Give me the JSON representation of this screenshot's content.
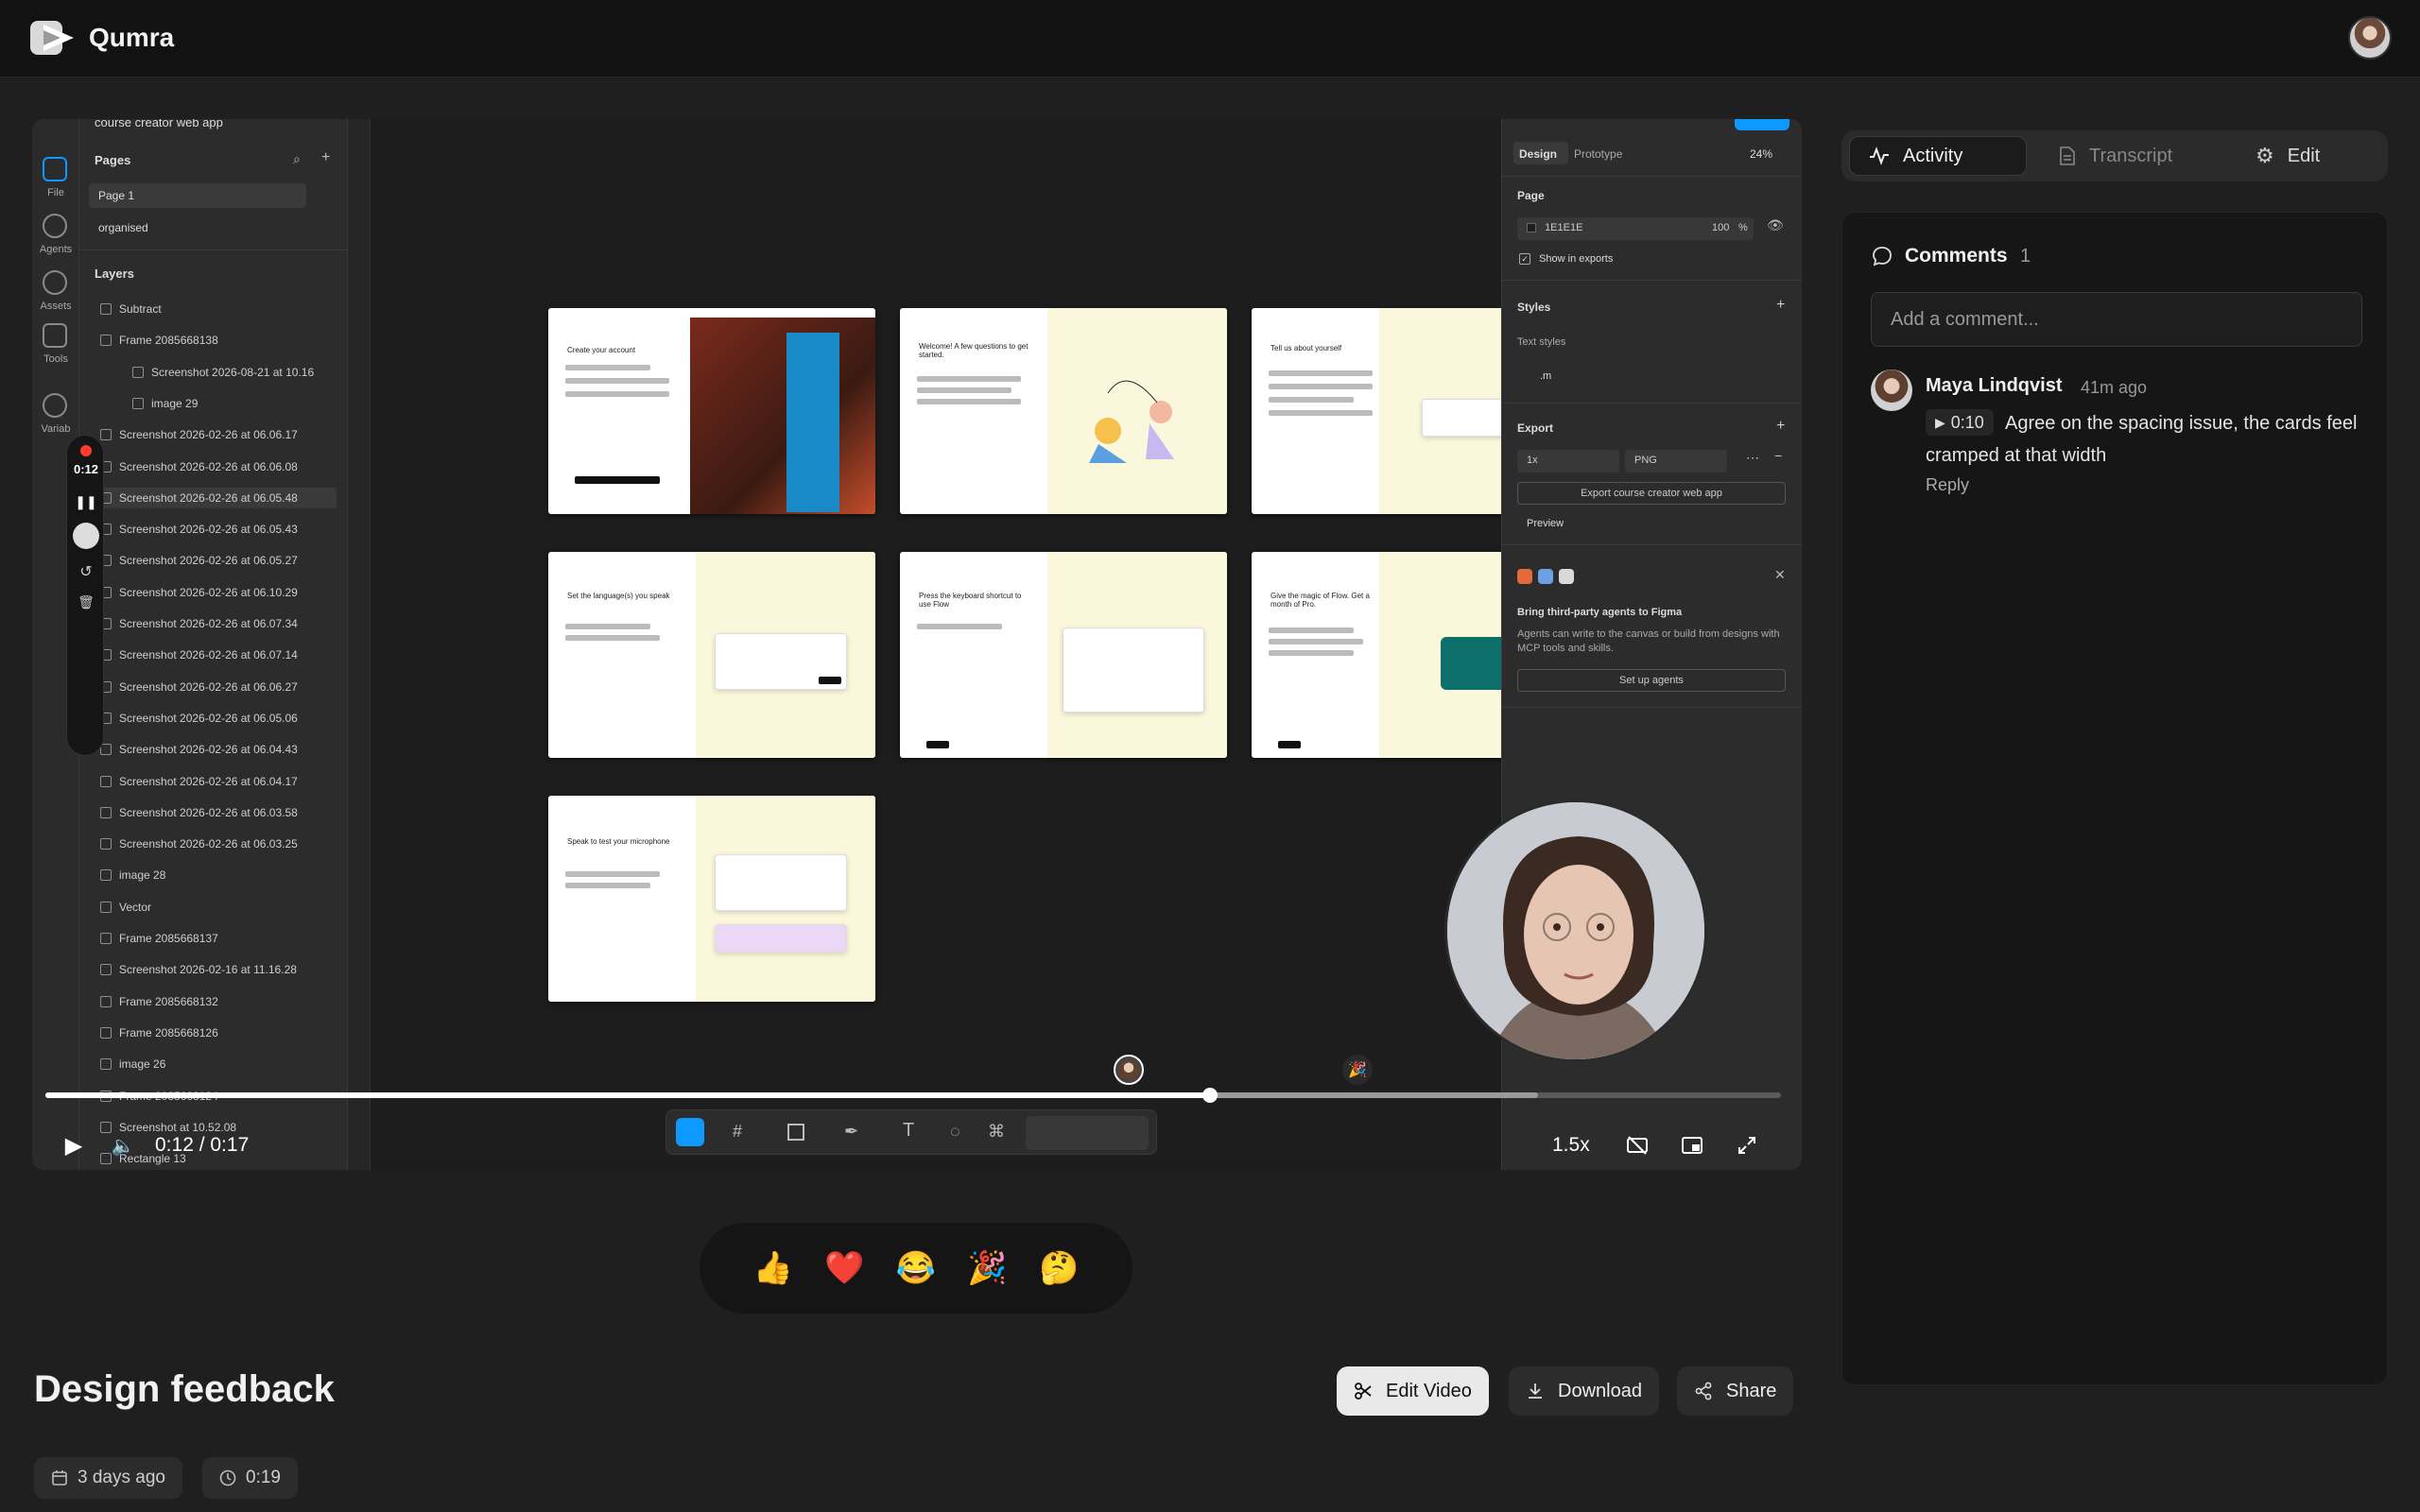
{
  "app": {
    "name": "Qumra"
  },
  "video": {
    "time_label": "0:12 / 0:17",
    "progress": 0.671,
    "buffered": 0.86,
    "speed": "1.5x",
    "recorder_time": "0:12",
    "figma": {
      "file_title": "course creator web app",
      "rail": [
        "File",
        "Agents",
        "Assets",
        "Tools",
        "Variab"
      ],
      "pages_header": "Pages",
      "pages": [
        "Page 1",
        "organised"
      ],
      "layers_header": "Layers",
      "layers": [
        "Subtract",
        "Frame 2085668138",
        "Screenshot 2026-08-21 at 10.16",
        "image 29",
        "Screenshot 2026-02-26 at 06.06.17",
        "Screenshot 2026-02-26 at 06.06.08",
        "Screenshot 2026-02-26 at 06.05.48",
        "Screenshot 2026-02-26 at 06.05.43",
        "Screenshot 2026-02-26 at 06.05.27",
        "Screenshot 2026-02-26 at 06.10.29",
        "Screenshot 2026-02-26 at 06.07.34",
        "Screenshot 2026-02-26 at 06.07.14",
        "Screenshot 2026-02-26 at 06.06.27",
        "Screenshot 2026-02-26 at 06.05.06",
        "Screenshot 2026-02-26 at 06.04.43",
        "Screenshot 2026-02-26 at 06.04.17",
        "Screenshot 2026-02-26 at 06.03.58",
        "Screenshot 2026-02-26 at 06.03.25",
        "image 28",
        "Vector",
        "Frame 2085668137",
        "Screenshot 2026-02-16 at 11.16.28",
        "Frame 2085668132",
        "Frame 2085668126",
        "image 26",
        "Frame 2085668124",
        "Screenshot at 10.52.08",
        "Rectangle 13"
      ],
      "thumbs": [
        "Create your account",
        "Welcome! A few questions to get started.",
        "Tell us about yourself",
        "Set the language(s) you speak",
        "Press the keyboard shortcut to use Flow",
        "Give the magic of Flow. Get a month of Pro.",
        "Speak to test your microphone"
      ],
      "right": {
        "tabs": [
          "Design",
          "Prototype"
        ],
        "zoom": "24%",
        "page_label": "Page",
        "page_color": "1E1E1E",
        "page_opacity": "100",
        "page_opacity_unit": "%",
        "show_in_exports": "Show in exports",
        "styles_label": "Styles",
        "text_styles_label": "Text styles",
        "text_style_item": ".m",
        "export_label": "Export",
        "export_scale": "1x",
        "export_format": "PNG",
        "export_button": "Export course creator web app",
        "preview_label": "Preview",
        "agents_title": "Bring third-party agents to Figma",
        "agents_desc": "Agents can write to the canvas or build from designs with MCP tools and skills.",
        "agents_button": "Set up agents"
      }
    }
  },
  "reactions": [
    "👍",
    "❤️",
    "😂",
    "🎉",
    "🤔"
  ],
  "details": {
    "title": "Design feedback",
    "date": "3 days ago",
    "duration": "0:19",
    "edit_label": "Edit Video",
    "download_label": "Download",
    "share_label": "Share"
  },
  "sidebar": {
    "tabs": {
      "activity": "Activity",
      "transcript": "Transcript",
      "edit": "Edit"
    },
    "comments_title": "Comments",
    "comments_count": "1",
    "comment_placeholder": "Add a comment...",
    "comments": [
      {
        "author": "Maya Lindqvist",
        "time": "41m ago",
        "timestamp": "0:10",
        "text": "Agree on the spacing issue, the cards feel cramped at that width",
        "reply_label": "Reply"
      }
    ]
  },
  "colors": {
    "accent": "#ffffff",
    "bg": "#1f1f1f",
    "panel": "#161616",
    "figma_blue": "#0d99ff"
  }
}
